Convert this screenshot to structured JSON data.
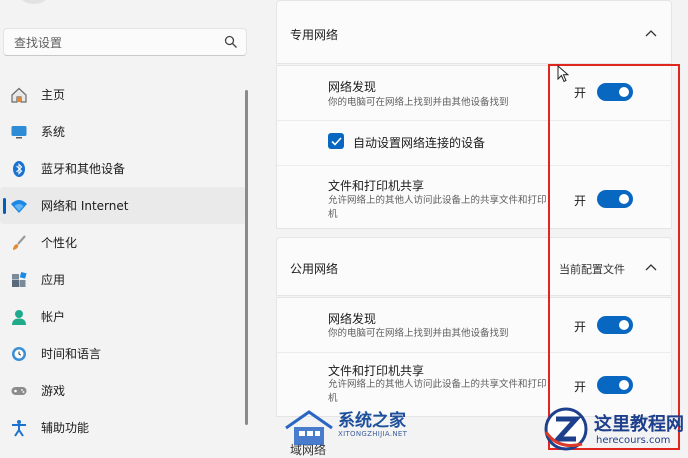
{
  "search": {
    "placeholder": "查找设置",
    "icon": "search-icon"
  },
  "nav": [
    {
      "label": "主页",
      "icon": "home-icon"
    },
    {
      "label": "系统",
      "icon": "system-icon"
    },
    {
      "label": "蓝牙和其他设备",
      "icon": "bluetooth-icon"
    },
    {
      "label": "网络和 Internet",
      "icon": "wifi-icon",
      "active": true
    },
    {
      "label": "个性化",
      "icon": "brush-icon"
    },
    {
      "label": "应用",
      "icon": "apps-icon"
    },
    {
      "label": "帐户",
      "icon": "account-icon"
    },
    {
      "label": "时间和语言",
      "icon": "clock-globe-icon"
    },
    {
      "label": "游戏",
      "icon": "gamepad-icon"
    },
    {
      "label": "辅助功能",
      "icon": "accessibility-icon"
    }
  ],
  "private_network": {
    "title": "专用网络",
    "discovery": {
      "title": "网络发现",
      "desc": "你的电脑可在网络上找到并由其他设备找到",
      "toggle_label": "开",
      "on": true
    },
    "auto_setup": {
      "label": "自动设置网络连接的设备",
      "checked": true
    },
    "sharing": {
      "title": "文件和打印机共享",
      "desc": "允许网络上的其他人访问此设备上的共享文件和打印机",
      "toggle_label": "开",
      "on": true
    }
  },
  "public_network": {
    "title": "公用网络",
    "current_profile": "当前配置文件",
    "discovery": {
      "title": "网络发现",
      "desc": "你的电脑可在网络上找到并由其他设备找到",
      "toggle_label": "开",
      "on": true
    },
    "sharing": {
      "title": "文件和打印机共享",
      "desc": "允许网络上的其他人访问此设备上的共享文件和打印机",
      "toggle_label": "开",
      "on": true
    }
  },
  "next_section_title": "域网络",
  "watermarks": {
    "left": {
      "brand": "系统之家",
      "url": "XITONGZHIJIA.NET"
    },
    "right": {
      "brand": "这里教程网",
      "url": "herecours.com"
    }
  },
  "colors": {
    "accent": "#0867c1",
    "highlight_box": "#e0261f"
  }
}
